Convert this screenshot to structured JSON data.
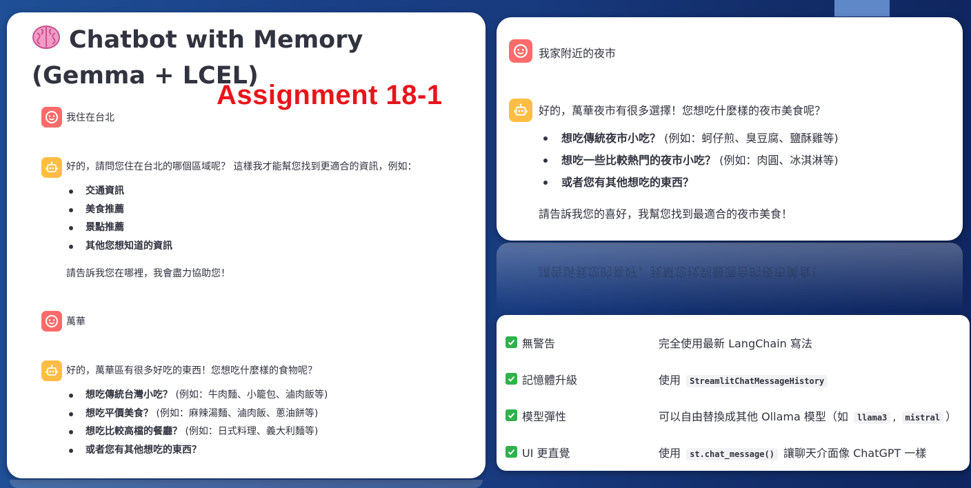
{
  "left_panel": {
    "title": "Chatbot with Memory (Gemma + LCEL)",
    "assignment_label": "Assignment 18-1",
    "messages": [
      {
        "role": "user",
        "text": "我住在台北"
      },
      {
        "role": "assistant",
        "intro": "好的，請問您住在台北的哪個區域呢？ 這樣我才能幫您找到更適合的資訊，例如：",
        "bullets": [
          {
            "bold": "交通資訊",
            "detail": ""
          },
          {
            "bold": "美食推薦",
            "detail": ""
          },
          {
            "bold": "景點推薦",
            "detail": ""
          },
          {
            "bold": "其他您想知道的資訊",
            "detail": ""
          }
        ],
        "outro": "請告訴我您在哪裡，我會盡力協助您！"
      },
      {
        "role": "user",
        "text": "萬華"
      },
      {
        "role": "assistant",
        "intro": "好的，萬華區有很多好吃的東西！您想吃什麼樣的食物呢？",
        "bullets": [
          {
            "bold": "想吃傳統台灣小吃？",
            "detail": " (例如：牛肉麵、小籠包、滷肉飯等)"
          },
          {
            "bold": "想吃平價美食？",
            "detail": " (例如：麻辣湯麵、滷肉飯、蔥油餅等)"
          },
          {
            "bold": "想吃比較高檔的餐廳？",
            "detail": " (例如：日式料理、義大利麵等)"
          },
          {
            "bold": "或者您有其他想吃的東西？",
            "detail": ""
          }
        ]
      }
    ]
  },
  "right_top_panel": {
    "messages": [
      {
        "role": "user",
        "text": "我家附近的夜市"
      },
      {
        "role": "assistant",
        "intro": "好的，萬華夜市有很多選擇！您想吃什麼樣的夜市美食呢？",
        "bullets": [
          {
            "bold": "想吃傳統夜市小吃？",
            "detail": " (例如：蚵仔煎、臭豆腐、鹽酥雞等)"
          },
          {
            "bold": "想吃一些比較熱門的夜市小吃？",
            "detail": " (例如：肉圓、冰淇淋等)"
          },
          {
            "bold": "或者您有其他想吃的東西？",
            "detail": ""
          }
        ],
        "outro": "請告訴我您的喜好，我幫您找到最適合的夜市美食！"
      }
    ]
  },
  "feature_table": {
    "rows": [
      {
        "name": "無警告",
        "desc_before": "完全使用最新 LangChain 寫法",
        "code1": "",
        "desc_middle": "",
        "code2": "",
        "desc_after": ""
      },
      {
        "name": "記憶體升級",
        "desc_before": "使用",
        "code1": "StreamlitChatMessageHistory",
        "desc_middle": "",
        "code2": "",
        "desc_after": ""
      },
      {
        "name": "模型彈性",
        "desc_before": "可以自由替換成其他 Ollama 模型（如",
        "code1": "llama3",
        "desc_middle": ",",
        "code2": "mistral",
        "desc_after": "）"
      },
      {
        "name": "UI 更直覺",
        "desc_before": "使用",
        "code1": "st.chat_message()",
        "desc_middle": "讓聊天介面像 ChatGPT 一樣",
        "code2": "",
        "desc_after": ""
      }
    ]
  },
  "colors": {
    "user_avatar": "#ff6b6b",
    "bot_avatar": "#ffbd45",
    "assignment_text": "#e8141b",
    "checkbox": "#2fb14b",
    "background": "#183a7e"
  },
  "icons": {
    "title": "brain-icon",
    "user": "smiley-face-icon",
    "assistant": "robot-icon",
    "check": "checkmark-icon"
  }
}
